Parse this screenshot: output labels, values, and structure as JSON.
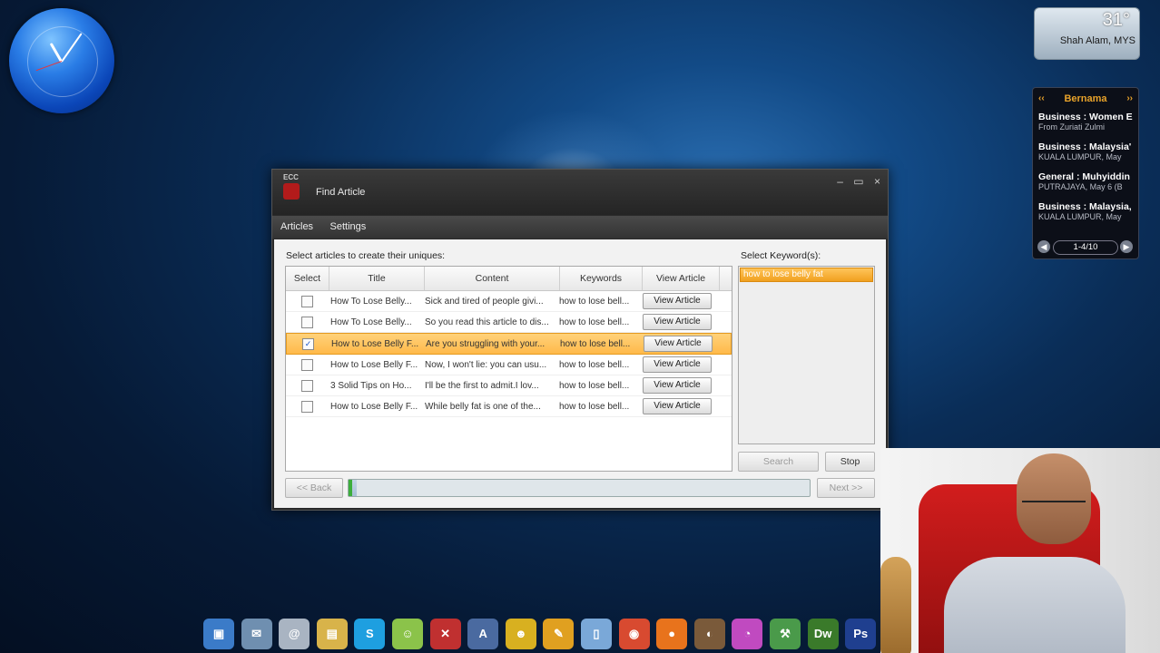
{
  "desktop": {
    "weather": {
      "temp": "31°",
      "location": "Shah Alam, MYS"
    },
    "news": {
      "source": "Bernama",
      "prev_icon": "double-chevron-left-icon",
      "next_icon": "double-chevron-right-icon",
      "items": [
        {
          "title": "Business : Women E",
          "subtitle": "From Zuriati Zulmi"
        },
        {
          "title": "Business : Malaysia'",
          "subtitle": "KUALA LUMPUR, May"
        },
        {
          "title": "General : Muhyiddin",
          "subtitle": "PUTRAJAYA, May 6 (B"
        },
        {
          "title": "Business : Malaysia,",
          "subtitle": "KUALA LUMPUR, May"
        }
      ],
      "pager": "1-4/10"
    }
  },
  "window": {
    "logo_text": "ECC",
    "title": "Find Article",
    "controls": {
      "minimize": "–",
      "maximize": "▭",
      "close": "×"
    },
    "menu": [
      "Articles",
      "Settings"
    ],
    "articles_label": "Select articles to create their uniques:",
    "keywords_label": "Select Keyword(s):",
    "columns": [
      "Select",
      "Title",
      "Content",
      "Keywords",
      "View Article"
    ],
    "rows": [
      {
        "checked": false,
        "selected": false,
        "title": "How To Lose Belly...",
        "content": "Sick and tired of people givi...",
        "keywords": "how to lose bell...",
        "action": "View Article"
      },
      {
        "checked": false,
        "selected": false,
        "title": "How To Lose Belly...",
        "content": "So you read this article to dis...",
        "keywords": "how to lose bell...",
        "action": "View Article"
      },
      {
        "checked": true,
        "selected": true,
        "title": "How to Lose Belly F...",
        "content": "Are you struggling with your...",
        "keywords": "how to lose bell...",
        "action": "View Article"
      },
      {
        "checked": false,
        "selected": false,
        "title": "How to Lose Belly F...",
        "content": "Now, I won't lie: you can usu...",
        "keywords": "how to lose bell...",
        "action": "View Article"
      },
      {
        "checked": false,
        "selected": false,
        "title": "3 Solid Tips on Ho...",
        "content": "I'll be the first to admit.I lov...",
        "keywords": "how to lose bell...",
        "action": "View Article"
      },
      {
        "checked": false,
        "selected": false,
        "title": "How to Lose Belly F...",
        "content": "While belly fat is one of the...",
        "keywords": "how to lose bell...",
        "action": "View Article"
      }
    ],
    "keywords": [
      "how to lose belly fat"
    ],
    "buttons": {
      "search": "Search",
      "stop": "Stop",
      "back": "<< Back",
      "next": "Next >>"
    },
    "progress": 0.01
  },
  "dock": {
    "icons": [
      {
        "name": "computer-icon",
        "glyph": "▣",
        "color": "#3b7bc8"
      },
      {
        "name": "mail-icon",
        "glyph": "✉",
        "color": "#6f8fb0"
      },
      {
        "name": "at-sign-icon",
        "glyph": "@",
        "color": "#a9b4c2"
      },
      {
        "name": "folder-icon",
        "glyph": "▤",
        "color": "#d8b34a"
      },
      {
        "name": "skype-icon",
        "glyph": "S",
        "color": "#1e9fe0"
      },
      {
        "name": "messenger-icon",
        "glyph": "☺",
        "color": "#8bc34a"
      },
      {
        "name": "tools-icon",
        "glyph": "✕",
        "color": "#c03030"
      },
      {
        "name": "dictionary-icon",
        "glyph": "A",
        "color": "#4a6aa0"
      },
      {
        "name": "yahoo-messenger-icon",
        "glyph": "☻",
        "color": "#d8b020"
      },
      {
        "name": "notes-icon",
        "glyph": "✎",
        "color": "#e0a020"
      },
      {
        "name": "document-icon",
        "glyph": "▯",
        "color": "#7aa8d8"
      },
      {
        "name": "chrome-icon",
        "glyph": "◉",
        "color": "#d84a30"
      },
      {
        "name": "firefox-icon",
        "glyph": "●",
        "color": "#e8731c"
      },
      {
        "name": "gimp-icon",
        "glyph": "◐",
        "color": "#7a5a3a"
      },
      {
        "name": "picasa-icon",
        "glyph": "◔",
        "color": "#c04ac0"
      },
      {
        "name": "network-icon",
        "glyph": "⚒",
        "color": "#4a9a4a"
      },
      {
        "name": "dreamweaver-icon",
        "glyph": "Dw",
        "color": "#3a7a2a"
      },
      {
        "name": "photoshop-icon",
        "glyph": "Ps",
        "color": "#1f3f8f"
      }
    ]
  }
}
